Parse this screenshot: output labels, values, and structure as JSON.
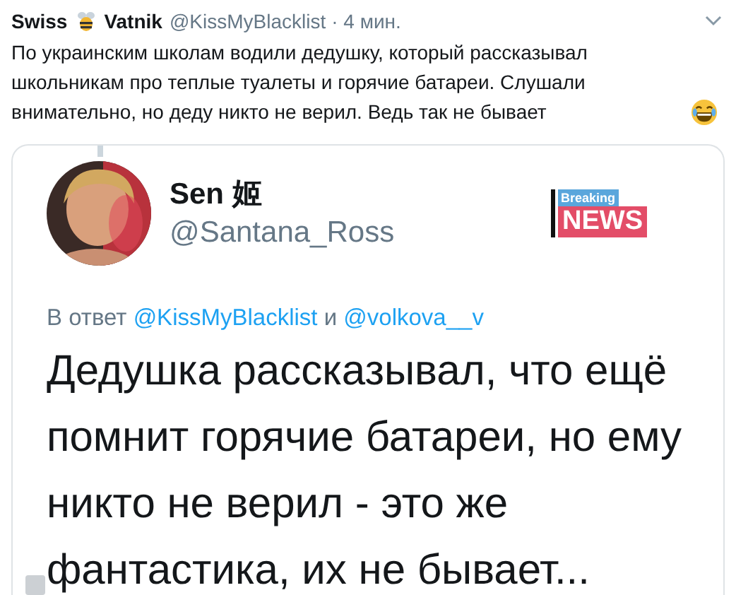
{
  "tweet": {
    "name_first": "Swiss",
    "name_last": "Vatnik",
    "handle": "@KissMyBlacklist",
    "time": "· 4 мин.",
    "text": "По украинским школам водили дедушку, который рассказывал школьникам про теплые туалеты и горячие батареи. Слушали внимательно, но деду никто не верил. Ведь так не бывает"
  },
  "embedded": {
    "kind": "picture",
    "name": "Sen 姬",
    "handle": "@Santana_Ross",
    "logo": {
      "top": "Breaking",
      "bottom": "NEWS"
    },
    "reply_prefix": "В ответ",
    "reply_to": [
      "@KissMyBlacklist",
      "@volkova__v"
    ],
    "reply_joiner": "и",
    "text": "Дедушка рассказывал, что ещё помнит горячие батареи, но ему никто не верил - это же фантастика, их не бывает..."
  }
}
